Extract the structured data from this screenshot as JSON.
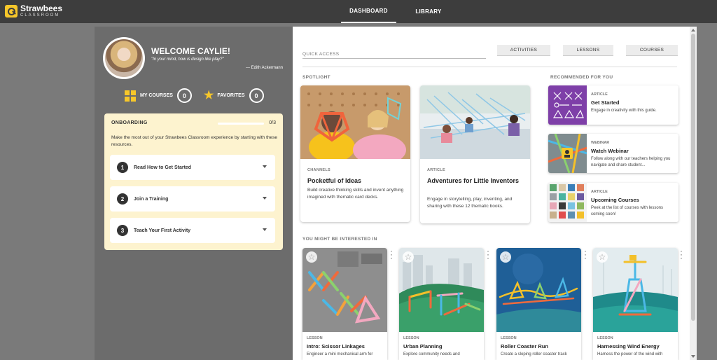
{
  "app": {
    "logo_name": "Strawbees",
    "logo_sub": "CLASSROOM"
  },
  "nav": {
    "dashboard": "DASHBOARD",
    "library": "LIBRARY"
  },
  "profile": {
    "welcome": "WELCOME CAYLIE!",
    "quote": "\"In your mind, how is design like play?\"",
    "quote_author": "— Edith Ackermann",
    "my_courses_label": "MY COURSES",
    "my_courses_count": "0",
    "favorites_label": "FAVORITES",
    "favorites_count": "0"
  },
  "onboarding": {
    "title": "ONBOARDING",
    "progress_text": "0/3",
    "progress_fraction": 0,
    "description": "Make the most out of your Strawbees Classroom experience by starting with these resources.",
    "steps": [
      {
        "num": "1",
        "label": "Read How to Get Started"
      },
      {
        "num": "2",
        "label": "Join a Training"
      },
      {
        "num": "3",
        "label": "Teach Your First Activity"
      }
    ]
  },
  "quick_access": {
    "label": "QUICK ACCESS",
    "buttons": [
      "ACTIVITIES",
      "LESSONS",
      "COURSES"
    ]
  },
  "spotlight": {
    "label": "SPOTLIGHT",
    "cards": [
      {
        "kicker": "CHANNELS",
        "title": "Pocketful of Ideas",
        "desc": "Build creative thinking skills and invent anything imagined with thematic card decks."
      },
      {
        "kicker": "ARTICLE",
        "title": "Adventures for Little Inventors",
        "desc": "Engage in storytelling, play, inventing, and sharing with these 12 thematic books."
      }
    ]
  },
  "recommended": {
    "label": "RECOMMENDED FOR YOU",
    "items": [
      {
        "kicker": "ARTICLE",
        "title": "Get Started",
        "desc": "Engage in creativity with this guide."
      },
      {
        "kicker": "WEBINAR",
        "title": "Watch Webinar",
        "desc": "Follow along with our teachers helping you navigate and share student..."
      },
      {
        "kicker": "ARTICLE",
        "title": "Upcoming Courses",
        "desc": "Peek at the list of courses with lessons coming soon!"
      }
    ]
  },
  "interested": {
    "label": "YOU MIGHT BE INTERESTED IN",
    "lessons": [
      {
        "kicker": "LESSON",
        "title": "Intro: Scissor Linkages",
        "desc": "Engineer a mini mechanical arm for"
      },
      {
        "kicker": "LESSON",
        "title": "Urban Planning",
        "desc": "Explore community needs and"
      },
      {
        "kicker": "LESSON",
        "title": "Roller Coaster Run",
        "desc": "Create a sloping roller coaster track"
      },
      {
        "kicker": "LESSON",
        "title": "Harnessing Wind Energy",
        "desc": "Harness the power of the wind with"
      }
    ]
  },
  "colors": {
    "accent": "#f7c72a",
    "topbar": "#3d3d3d",
    "sidebar": "#6c6c6c",
    "onboarding_bg": "#fdf3cf"
  }
}
